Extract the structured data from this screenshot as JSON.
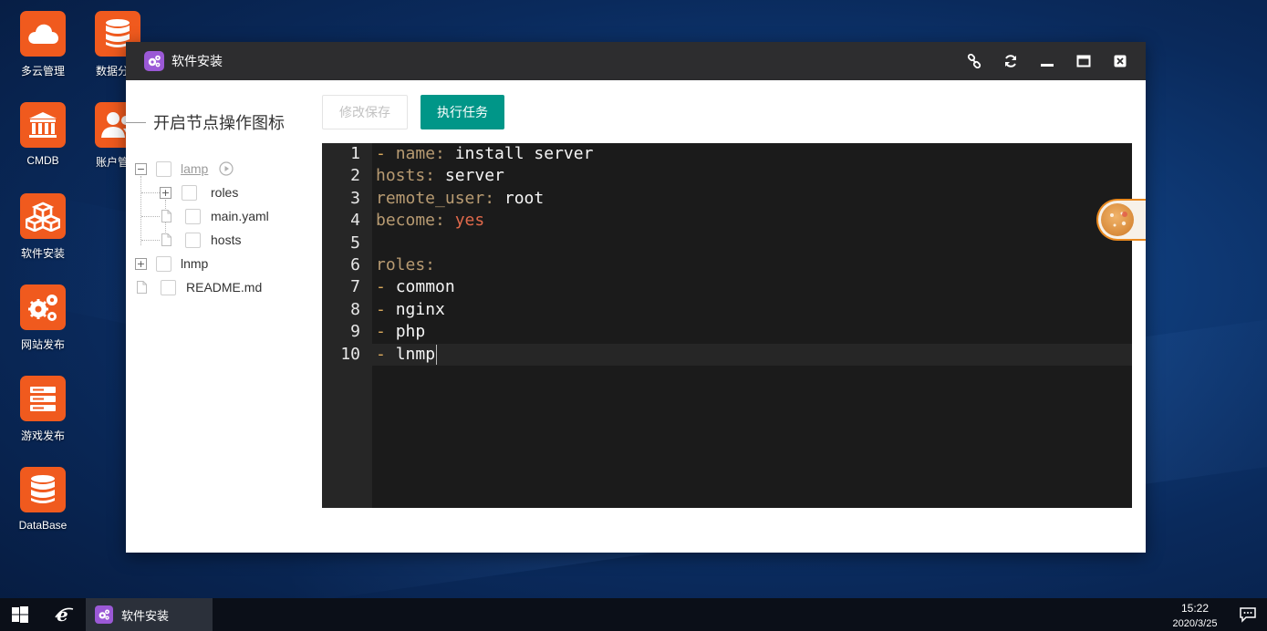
{
  "desktop": {
    "icons": [
      {
        "label": "多云管理",
        "icon": "cloud-icon"
      },
      {
        "label": "CMDB",
        "icon": "bank-icon"
      },
      {
        "label": "软件安装",
        "icon": "cubes-icon"
      },
      {
        "label": "网站发布",
        "icon": "gears-icon"
      },
      {
        "label": "游戏发布",
        "icon": "server-icon"
      },
      {
        "label": "DataBase",
        "icon": "database-icon"
      },
      {
        "label": "数据分析",
        "icon": "database-icon"
      },
      {
        "label": "账户管理",
        "icon": "users-icon"
      }
    ]
  },
  "window": {
    "title": "软件安装",
    "controls": [
      "link-icon",
      "refresh-icon",
      "minimize-icon",
      "maximize-icon",
      "close-icon"
    ],
    "tree_title": "开启节点操作图标",
    "tree": [
      {
        "label": "lamp",
        "expand": "−",
        "type": "folder"
      },
      {
        "label": "roles",
        "expand": "+",
        "type": "folder"
      },
      {
        "label": "main.yaml",
        "type": "file"
      },
      {
        "label": "hosts",
        "type": "file"
      },
      {
        "label": "lnmp",
        "expand": "+",
        "type": "folder"
      },
      {
        "label": "README.md",
        "type": "file"
      }
    ],
    "buttons": {
      "save": "修改保存",
      "run": "执行任务"
    },
    "editor": {
      "line_numbers": [
        "1",
        "2",
        "3",
        "4",
        "5",
        "6",
        "7",
        "8",
        "9",
        "10"
      ],
      "lines": [
        {
          "dash": "- ",
          "key": "name:",
          "val": " install server"
        },
        {
          "key": "hosts:",
          "val": " server"
        },
        {
          "key": "remote_user:",
          "val": " root"
        },
        {
          "key": "become:",
          "bool": " yes"
        },
        {},
        {
          "key": "roles:"
        },
        {
          "dash": "- ",
          "val": "common"
        },
        {
          "dash": "- ",
          "val": "nginx"
        },
        {
          "dash": "- ",
          "val": "php"
        },
        {
          "dash": "- ",
          "val": "lnmp"
        }
      ],
      "active_line": 10
    }
  },
  "taskbar": {
    "app_label": "软件安装",
    "time": "15:22",
    "date": "2020/3/25"
  },
  "colors": {
    "accent_orange": "#f05a1e",
    "run_button": "#009688",
    "app_badge": "#9b59d6"
  }
}
